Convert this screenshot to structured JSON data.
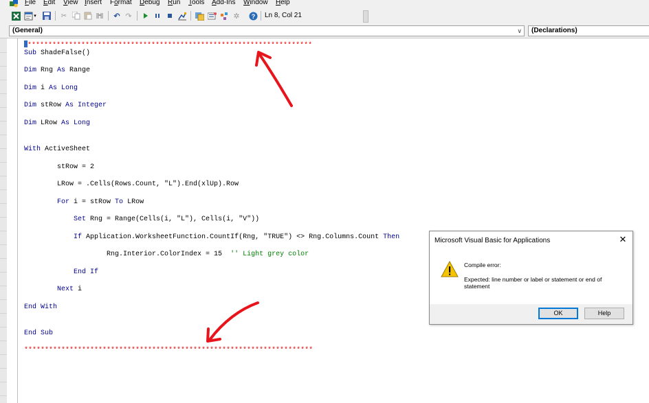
{
  "menu": {
    "items": [
      {
        "pre": "",
        "ul": "F",
        "post": "ile"
      },
      {
        "pre": "",
        "ul": "E",
        "post": "dit"
      },
      {
        "pre": "",
        "ul": "V",
        "post": "iew"
      },
      {
        "pre": "",
        "ul": "I",
        "post": "nsert"
      },
      {
        "pre": "F",
        "ul": "o",
        "post": "rmat"
      },
      {
        "pre": "",
        "ul": "D",
        "post": "ebug"
      },
      {
        "pre": "",
        "ul": "R",
        "post": "un"
      },
      {
        "pre": "",
        "ul": "T",
        "post": "ools"
      },
      {
        "pre": "",
        "ul": "A",
        "post": "dd-Ins"
      },
      {
        "pre": "",
        "ul": "W",
        "post": "indow"
      },
      {
        "pre": "",
        "ul": "H",
        "post": "elp"
      }
    ]
  },
  "toolbar": {
    "position": "Ln 8, Col 21",
    "icons": [
      "excel-icon",
      "insert-userform-icon",
      "save-icon",
      "cut-icon",
      "copy-icon",
      "paste-icon",
      "find-icon",
      "undo-icon",
      "redo-icon",
      "run-icon",
      "break-icon",
      "reset-icon",
      "design-mode-icon",
      "project-explorer-icon",
      "properties-icon",
      "object-browser-icon",
      "toolbox-icon",
      "help-icon"
    ]
  },
  "combos": {
    "object": "(General)",
    "procedure": "(Declarations)"
  },
  "code": {
    "line1_stars": "*********************************************************************",
    "sub_decl": "Sub",
    "sub_name": " ShadeFalse()",
    "dim": "Dim",
    "as": "As",
    "dim_rng_name": " Rng ",
    "dim_rng_type": " Range",
    "dim_i_name": " i ",
    "dim_i_type": " Long",
    "dim_strow_name": " stRow ",
    "dim_strow_type": " Integer",
    "dim_lrow_name": " LRow ",
    "dim_lrow_type": " Long",
    "with_kw": "With",
    "with_rest": " ActiveSheet",
    "strow_assign": "        stRow = 2",
    "lrow_assign": "        LRow = .Cells(Rows.Count, \"L\").End(xlUp).Row",
    "for_indent": "        ",
    "for_kw": "For",
    "for_mid": " i = stRow ",
    "to_kw": "To",
    "for_end": " LRow",
    "set_indent": "            ",
    "set_kw": "Set",
    "set_rest": " Rng = Range(Cells(i, \"L\"), Cells(i, \"V\"))",
    "if_indent": "            ",
    "if_kw": "If",
    "if_rest": " Application.WorksheetFunction.CountIf(Rng, \"TRUE\") <> Rng.Columns.Count ",
    "then_kw": "Then",
    "interior_stmt": "                    Rng.Interior.ColorIndex = 15  ",
    "interior_comment": "'' Light grey color",
    "endif_indent": "            ",
    "endif_kw": "End If",
    "next_indent": "        ",
    "next_kw": "Next",
    "next_rest": " i",
    "endwith_kw": "End With",
    "endsub_kw": "End Sub",
    "last_stars": "**********************************************************************"
  },
  "dialog": {
    "title": "Microsoft Visual Basic for Applications",
    "close": "✕",
    "message1": "Compile error:",
    "message2": "Expected: line number or label or statement or end of statement",
    "ok": "OK",
    "help": "Help"
  },
  "colors": {
    "keyword": "#00008b",
    "comment": "#008000",
    "error_red": "#e00000",
    "annotation_arrow": "#e8141b"
  }
}
